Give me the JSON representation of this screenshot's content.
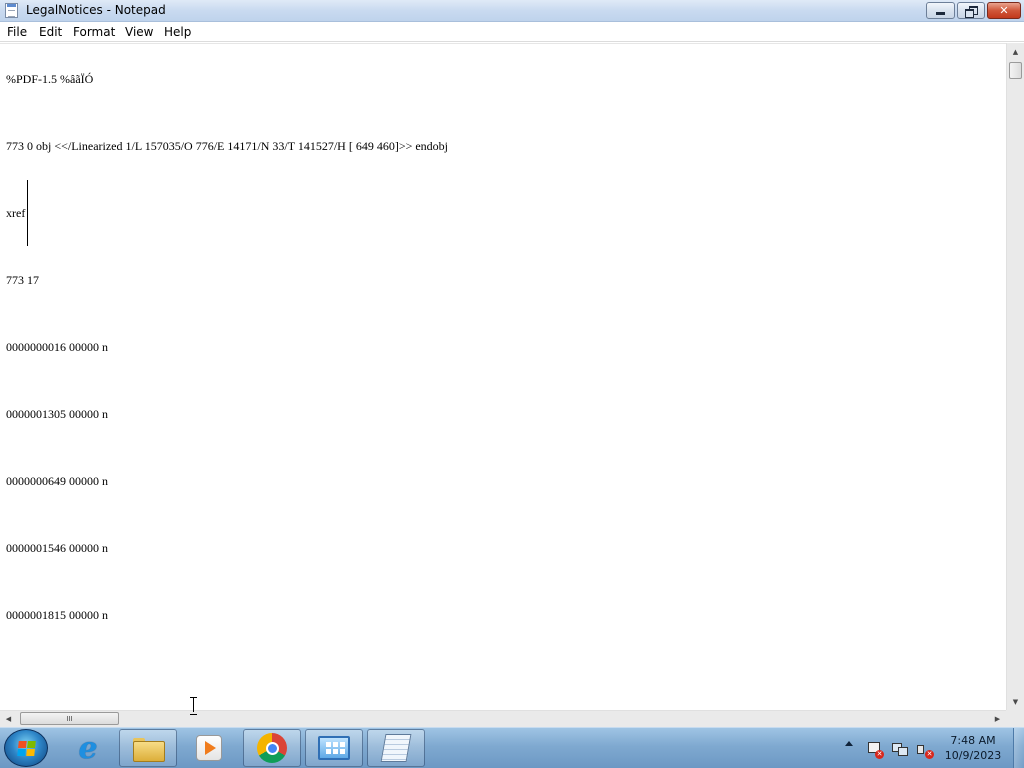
{
  "window": {
    "title": "LegalNotices - Notepad",
    "buttons": {
      "close_glyph": "✕"
    }
  },
  "menu": {
    "items": [
      {
        "label": "File"
      },
      {
        "label": "Edit"
      },
      {
        "label": "Format"
      },
      {
        "label": "View"
      },
      {
        "label": "Help"
      }
    ]
  },
  "document": {
    "lines": [
      "%PDF-1.5 %âãÏÓ",
      "773 0 obj <</Linearized 1/L 157035/O 776/E 14171/N 33/T 141527/H [ 649 460]>> endobj",
      "xref",
      "773 17",
      "0000000016 00000 n",
      "0000001305 00000 n",
      "0000000649 00000 n",
      "0000001546 00000 n",
      "0000001815 00000 n"
    ]
  },
  "scrollbars": {
    "up_arrow": "▲",
    "down_arrow": "▼",
    "left_arrow": "◀",
    "right_arrow": "▶"
  },
  "taskbar": {
    "ie_glyph": "e",
    "apps": [
      {
        "icon": "internet-explorer-icon"
      },
      {
        "icon": "folder-icon"
      },
      {
        "icon": "media-player-icon"
      },
      {
        "icon": "chrome-icon"
      },
      {
        "icon": "control-panel-icon"
      },
      {
        "icon": "notepad-icon"
      }
    ],
    "tray": {
      "time": "7:48 AM",
      "date": "10/9/2023"
    }
  }
}
